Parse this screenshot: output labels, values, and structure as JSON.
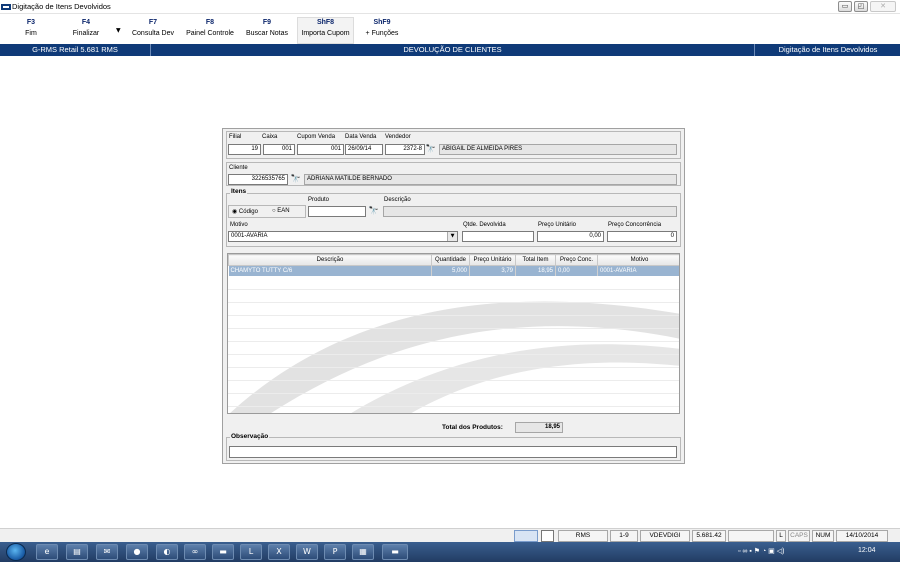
{
  "window": {
    "title": "Digitação de Itens Devolvidos",
    "minimize": "▭",
    "maximize": "◰",
    "close": "✕"
  },
  "toolbar": {
    "items": [
      {
        "key": "F3",
        "label": "Fim"
      },
      {
        "key": "F4",
        "label": "Finalizar"
      },
      {
        "key": "F7",
        "label": "Consulta Dev"
      },
      {
        "key": "F8",
        "label": "Painel Controle"
      },
      {
        "key": "F9",
        "label": "Buscar Notas"
      },
      {
        "key": "ShF8",
        "label": "Importa Cupom"
      },
      {
        "key": "ShF9",
        "label": "+ Funções"
      }
    ]
  },
  "header": {
    "left": "G-RMS Retail 5.681 RMS",
    "center": "DEVOLUÇÃO DE CLIENTES",
    "right": "Digitação de Itens Devolvidos"
  },
  "venda": {
    "labels": {
      "filial": "Filial",
      "caixa": "Caixa",
      "cupom": "Cupom Venda",
      "data": "Data Venda",
      "vendedor": "Vendedor"
    },
    "filial": "19",
    "caixa": "001",
    "cupom": "001",
    "data": "26/09/14",
    "vendedor_code": "2372-8",
    "vendedor_nome": "ABIGAIL DE ALMEIDA PIRES"
  },
  "cliente": {
    "label": "Cliente",
    "codigo": "3226535765",
    "nome": "ADRIANA MATILDE BERNADO"
  },
  "itens": {
    "title": "Itens",
    "produto_label": "Produto",
    "descricao_label": "Descrição",
    "codigo_option": "Código",
    "ean_option": "EAN",
    "motivo_label": "Motivo",
    "motivo_value": "0001-AVARIA",
    "qtde_label": "Qtde. Devolvida",
    "preco_unit_label": "Preço Unitário",
    "preco_unit_value": "0,00",
    "preco_conc_label": "Preço Concorrência",
    "preco_conc_value": "0"
  },
  "grid": {
    "columns": [
      "Descrição",
      "Quantidade",
      "Preço Unitário",
      "Total Item",
      "Preço Conc.",
      "Motivo"
    ],
    "rows": [
      [
        "CHAMYTO TUTTY C/6",
        "5,000",
        "3,79",
        "18,95",
        "0,00",
        "0001-AVARIA"
      ]
    ]
  },
  "totals": {
    "label": "Total dos Produtos:",
    "value": "18,95"
  },
  "observacao": {
    "label": "Observação"
  },
  "statusbar": {
    "app": "RMS",
    "range": "1-9",
    "screen": "VDEVDIGI",
    "version": "5.681.42",
    "l": "L",
    "caps": "CAPS",
    "num": "NUM",
    "date": "14/10/2014"
  },
  "taskbar": {
    "time": "12:04"
  },
  "colors": {
    "header_bg": "#0f3a78",
    "selected_row": "#99b4d1",
    "form_bg": "#f0f0f0"
  }
}
